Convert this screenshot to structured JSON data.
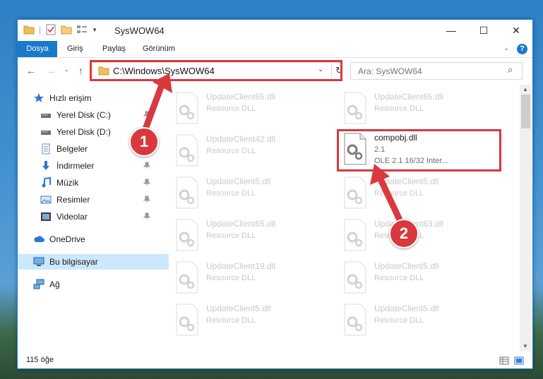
{
  "window": {
    "title": "SysWOW64",
    "controls": {
      "minimize": "—",
      "maximize": "☐",
      "close": "✕"
    }
  },
  "ribbon": {
    "tabs": [
      {
        "label": "Dosya"
      },
      {
        "label": "Giriş"
      },
      {
        "label": "Paylaş"
      },
      {
        "label": "Görünüm"
      }
    ],
    "help": "?"
  },
  "navbar": {
    "address": "C:\\Windows\\SysWOW64",
    "search_placeholder": "Ara: SysWOW64"
  },
  "sidebar": {
    "items": [
      {
        "label": "Hızlı erişim",
        "icon": "star-icon"
      },
      {
        "label": "Yerel Disk (C:)",
        "icon": "drive-icon"
      },
      {
        "label": "Yerel Disk (D:)",
        "icon": "drive-icon"
      },
      {
        "label": "Belgeler",
        "icon": "documents-icon"
      },
      {
        "label": "İndirmeler",
        "icon": "download-icon"
      },
      {
        "label": "Müzik",
        "icon": "music-icon"
      },
      {
        "label": "Resimler",
        "icon": "pictures-icon"
      },
      {
        "label": "Videolar",
        "icon": "video-icon"
      },
      {
        "label": "OneDrive",
        "icon": "cloud-icon"
      },
      {
        "label": "Bu bilgisayar",
        "icon": "computer-icon"
      },
      {
        "label": "Ağ",
        "icon": "network-icon"
      }
    ]
  },
  "files": {
    "left": [
      {
        "name": "UpdateClient65.dll",
        "type": "Resource DLL"
      },
      {
        "name": "UpdateClient42.dll",
        "type": "Resource DLL"
      },
      {
        "name": "UpdateClient5.dll",
        "type": "Resource DLL"
      },
      {
        "name": "UpdateClient65.dll",
        "type": "Resource DLL"
      },
      {
        "name": "UpdateClient19.dll",
        "type": "Resource DLL"
      },
      {
        "name": "UpdateClient5.dll",
        "type": "Resource DLL"
      }
    ],
    "right_top": {
      "name": "UpdateClient65.dll",
      "type": "Resource DLL"
    },
    "highlighted": {
      "name": "compobj.dll",
      "version": "2.1",
      "description": "OLE 2.1 16/32 Inter..."
    },
    "right": [
      {
        "name": "UpdateClient5.dll",
        "type": "Resource DLL"
      },
      {
        "name": "UpdateClient63.dll",
        "type": "Resource DLL"
      },
      {
        "name": "UpdateClient5.dll",
        "type": "Resource DLL"
      },
      {
        "name": "UpdateClient5.dll",
        "type": "Resource DLL"
      }
    ]
  },
  "status": {
    "count": "115 öğe"
  },
  "callouts": {
    "one": "1",
    "two": "2"
  },
  "colors": {
    "accent": "#1979ca",
    "highlight": "#d9383f",
    "selected": "#cce8ff"
  }
}
